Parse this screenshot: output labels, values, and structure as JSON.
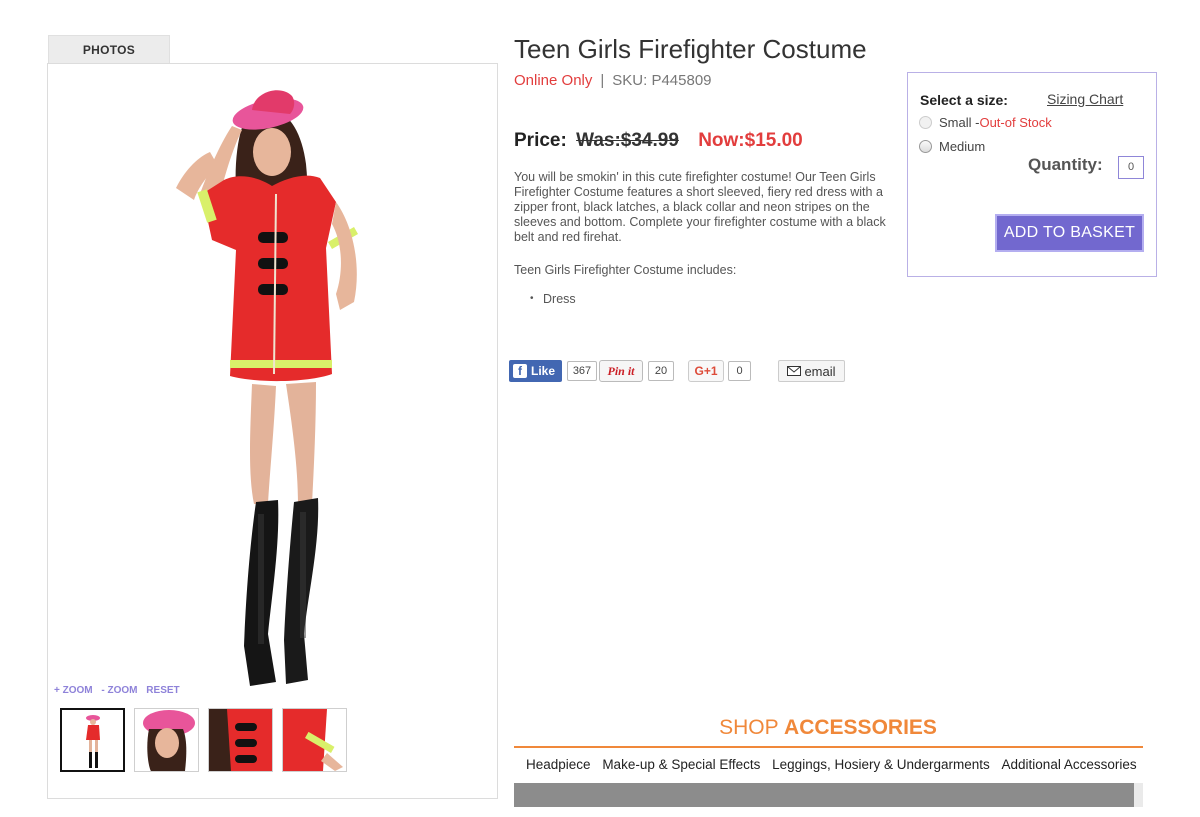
{
  "photos": {
    "tab_label": "PHOTOS",
    "zoom_in": "+ ZOOM",
    "zoom_out": "- ZOOM",
    "reset": "RESET",
    "thumb_count": 4
  },
  "product": {
    "title": "Teen Girls Firefighter Costume",
    "availability": "Online Only",
    "separator": "|",
    "sku": "SKU: P445809",
    "price_label": "Price:",
    "was_price": "Was:$34.99",
    "now_price": "Now:$15.00",
    "description": "You will be smokin' in this cute firefighter costume! Our Teen Girls Firefighter Costume features a short sleeved, fiery red dress with a zipper front, black latches, a black collar and neon stripes on the sleeves and bottom. Complete your firefighter costume with a black belt and red firehat.",
    "includes_label": "Teen Girls Firefighter Costume includes:",
    "includes": [
      "Dress"
    ]
  },
  "social": {
    "fb_label": "Like",
    "fb_count": "367",
    "pin_label": "Pin it",
    "pin_count": "20",
    "gplus_label": "G+1",
    "gplus_count": "0",
    "email_label": "email"
  },
  "purchase": {
    "size_label": "Select a size:",
    "sizing_chart": "Sizing Chart",
    "sizes": [
      {
        "name": "Small -",
        "status": "Out-of Stock",
        "available": false
      },
      {
        "name": "Medium",
        "status": "",
        "available": true
      }
    ],
    "quantity_label": "Quantity:",
    "quantity_value": "0",
    "add_button": "ADD TO BASKET"
  },
  "accessories": {
    "title_light": "SHOP ",
    "title_bold": "ACCESSORIES",
    "tabs": [
      "Headpiece",
      "Make-up & Special Effects",
      "Leggings, Hosiery & Undergarments",
      "Additional Accessories"
    ]
  },
  "colors": {
    "accent_red": "#e23d3d",
    "button_purple": "#7268cf",
    "accessories_orange": "#f0883a",
    "zoom_purple": "#8e82d9",
    "facebook_blue": "#4267b2"
  }
}
